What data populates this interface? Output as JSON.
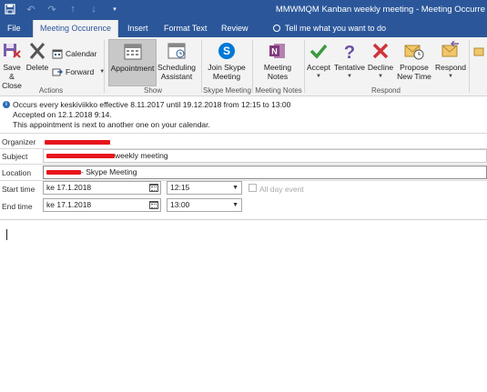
{
  "window": {
    "title": "MMWMQM Kanban weekly meeting  -  Meeting Occurre"
  },
  "tabs": [
    {
      "label": "File"
    },
    {
      "label": "Meeting Occurence"
    },
    {
      "label": "Insert"
    },
    {
      "label": "Format Text"
    },
    {
      "label": "Review"
    }
  ],
  "tell_me": "Tell me what you want to do",
  "ribbon": {
    "actions": {
      "group_label": "Actions",
      "save_close": "Save &\nClose",
      "delete": "Delete",
      "calendar": "Calendar",
      "forward": "Forward"
    },
    "show": {
      "group_label": "Show",
      "appointment": "Appointment",
      "scheduling": "Scheduling\nAssistant"
    },
    "skype": {
      "group_label": "Skype Meeting",
      "join": "Join Skype\nMeeting"
    },
    "notes": {
      "group_label": "Meeting Notes",
      "meeting_notes": "Meeting\nNotes"
    },
    "respond": {
      "group_label": "Respond",
      "accept": "Accept",
      "tentative": "Tentative",
      "decline": "Decline",
      "propose": "Propose\nNew Time",
      "respond": "Respond"
    }
  },
  "info": {
    "line1": "Occurs every keskiviikko effective 8.11.2017 until 19.12.2018 from 12:15 to 13:00",
    "line2": "Accepted on 12.1.2018 9:14.",
    "line3": "This appointment is next to another one on your calendar."
  },
  "form": {
    "organizer_label": "Organizer",
    "subject_label": "Subject",
    "subject_suffix": "weekly meeting",
    "location_label": "Location",
    "location_suffix": "- Skype Meeting",
    "start_label": "Start time",
    "start_date": "ke 17.1.2018",
    "start_time": "12:15",
    "all_day": "All day event",
    "end_label": "End time",
    "end_date": "ke 17.1.2018",
    "end_time": "13:00"
  },
  "colors": {
    "brand": "#2b579a",
    "redaction": "#e8141b",
    "accept": "#3a9b3e",
    "tentative": "#6b4fa0",
    "decline": "#d13438",
    "skype": "#0078d7",
    "onenote": "#80397b"
  }
}
